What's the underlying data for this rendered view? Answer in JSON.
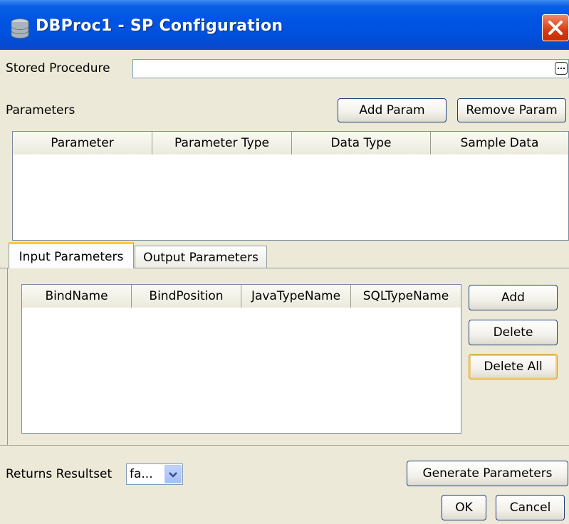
{
  "window": {
    "title": "DBProc1 - SP Configuration",
    "icon": "database-icon",
    "close_icon": "close-icon"
  },
  "stored_procedure": {
    "label": "Stored Procedure",
    "value": "",
    "browse_icon": "ellipsis-icon"
  },
  "parameters": {
    "label": "Parameters",
    "add_button": "Add Param",
    "remove_button": "Remove Param",
    "columns": [
      "Parameter",
      "Parameter Type",
      "Data Type",
      "Sample Data"
    ],
    "rows": []
  },
  "tabs": [
    {
      "label": "Input Parameters",
      "active": true
    },
    {
      "label": "Output Parameters",
      "active": false
    }
  ],
  "bind_table": {
    "columns": [
      "BindName",
      "BindPosition",
      "JavaTypeName",
      "SQLTypeName"
    ],
    "rows": []
  },
  "bind_buttons": {
    "add": "Add",
    "delete": "Delete",
    "delete_all": "Delete All"
  },
  "returns_resultset": {
    "label": "Returns Resultset",
    "value": "fa...",
    "arrow_icon": "chevron-down-icon"
  },
  "footer": {
    "generate": "Generate Parameters",
    "ok": "OK",
    "cancel": "Cancel"
  },
  "colors": {
    "titlebar": "#0054e3",
    "dialog_bg": "#ece9d8",
    "close": "#d83a12",
    "focus": "#f5cf75"
  }
}
